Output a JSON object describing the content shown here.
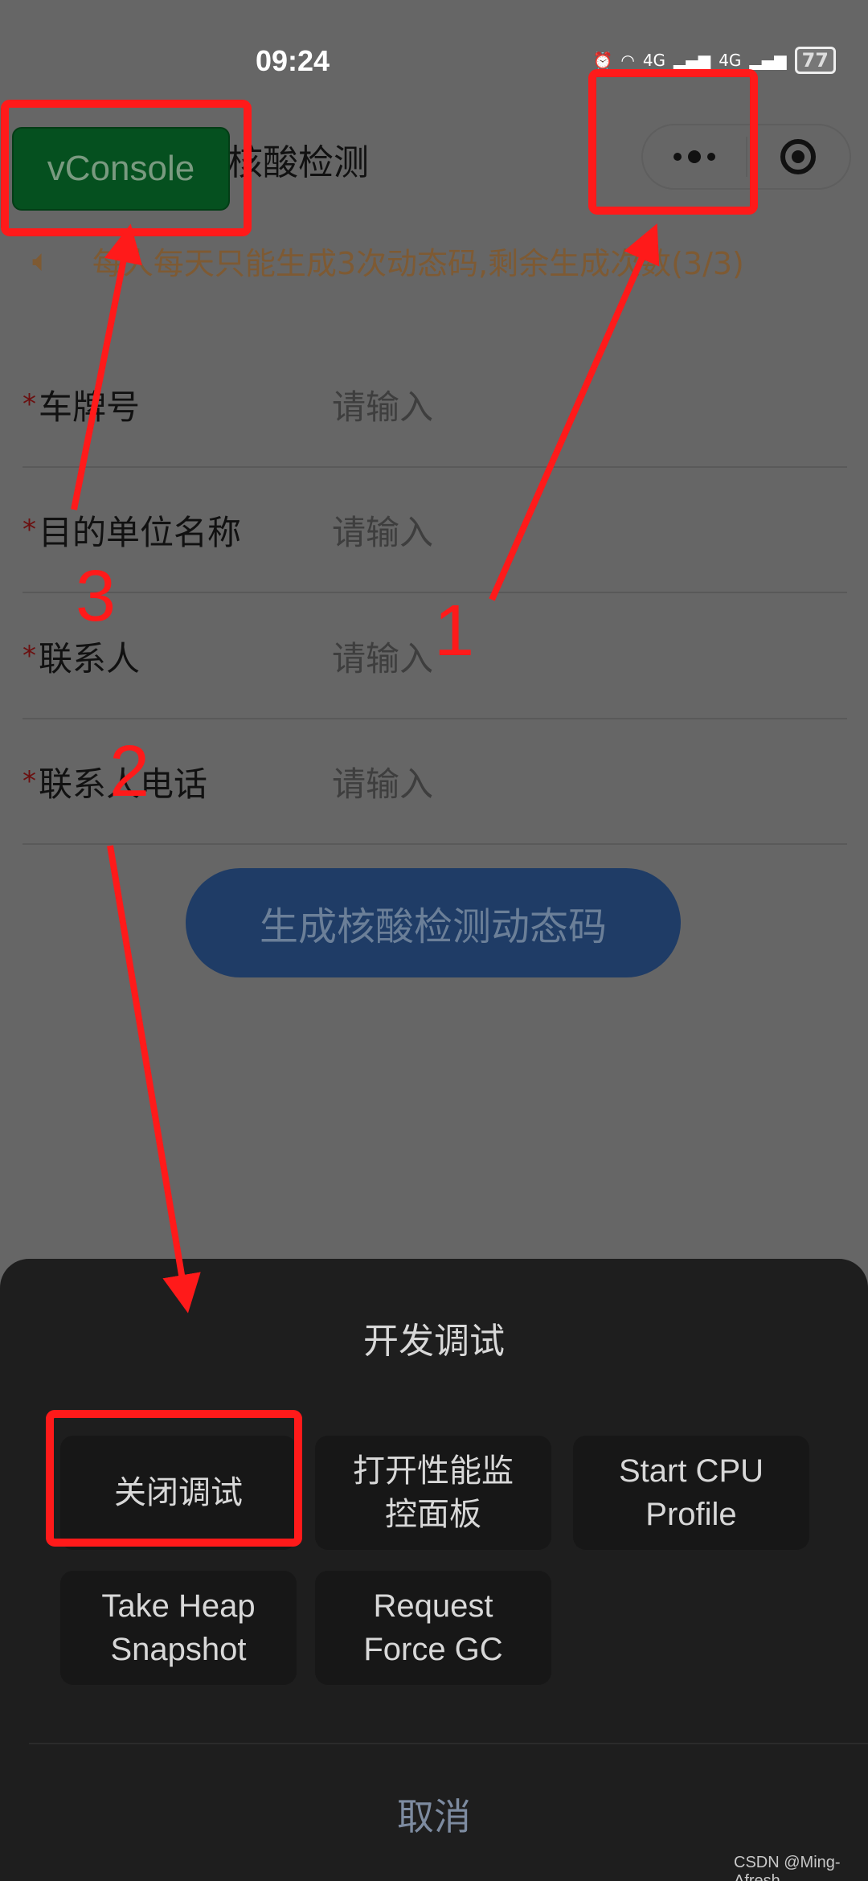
{
  "status_bar": {
    "time": "09:24",
    "network1": "4G",
    "network2": "4G",
    "battery": "77",
    "icons": [
      "alarm-icon",
      "wifi-icon",
      "signal-icon",
      "signal-icon",
      "battery-icon"
    ]
  },
  "nav": {
    "title": "核酸检测",
    "vconsole_label": "vConsole",
    "more_icon": "more-dots-icon",
    "close_icon": "target-circle-icon"
  },
  "notice": {
    "icon": "speaker-icon",
    "text": "每人每天只能生成3次动态码,剩余生成次数(3/3)"
  },
  "form": {
    "rows": [
      {
        "required": "*",
        "label": "车牌号",
        "placeholder": "请输入"
      },
      {
        "required": "*",
        "label": "目的单位名称",
        "placeholder": "请输入"
      },
      {
        "required": "*",
        "label": "联系人",
        "placeholder": "请输入"
      },
      {
        "required": "*",
        "label": "联系人电话",
        "placeholder": "请输入"
      }
    ],
    "submit_label": "生成核酸检测动态码"
  },
  "sheet": {
    "title": "开发调试",
    "actions": [
      "关闭调试",
      "打开性能监\n控面板",
      "Start CPU\nProfile",
      "Take Heap\nSnapshot",
      "Request\nForce GC"
    ],
    "cancel": "取消"
  },
  "annotations": {
    "labels": [
      "1",
      "2",
      "3"
    ],
    "color": "#ff1a1a"
  },
  "watermark": "CSDN @Ming-Afresh"
}
